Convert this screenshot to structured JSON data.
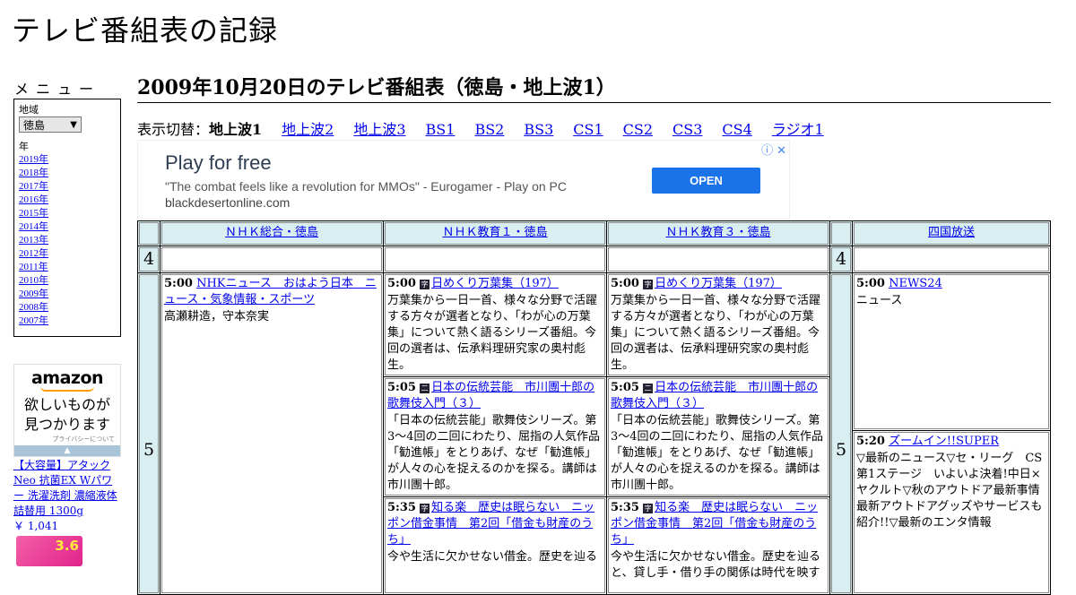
{
  "site": {
    "title": "テレビ番組表の記録"
  },
  "menu": {
    "heading": "メニュー",
    "region_label": "地域",
    "region_value": "徳島",
    "year_label": "年",
    "years": [
      "2019年",
      "2018年",
      "2017年",
      "2016年",
      "2015年",
      "2014年",
      "2013年",
      "2012年",
      "2011年",
      "2010年",
      "2009年",
      "2008年",
      "2007年"
    ]
  },
  "amazon_ad": {
    "logo": "amazon",
    "tagline_1": "欲しいものが",
    "tagline_2": "見つかります",
    "privacy": "プライバシーについて",
    "product_name": "【大容量】アタック Neo 抗菌EX Wパワー 洗濯洗剤 濃縮液体 詰替用 1300g",
    "product_price": "￥ 1,041",
    "product_badge": "3.6"
  },
  "page": {
    "heading": "2009年10月20日のテレビ番組表（徳島・地上波1）",
    "switch_label": "表示切替：",
    "current": "地上波1",
    "switch_links": [
      "地上波2",
      "地上波3",
      "BS1",
      "BS2",
      "BS3",
      "CS1",
      "CS2",
      "CS3",
      "CS4",
      "ラジオ1"
    ]
  },
  "google_ad": {
    "title": "Play for free",
    "quote": "\"The combat feels like a revolution for MMOs\" - Eurogamer - Play on PC",
    "domain": "blackdesertonline.com",
    "button": "OPEN",
    "info_icon": "ⓘ",
    "close_icon": "✕"
  },
  "schedule": {
    "channels": [
      "ＮＨＫ総合・徳島",
      "ＮＨＫ教育１・徳島",
      "ＮＨＫ教育３・徳島",
      "四国放送"
    ],
    "hours": [
      "4",
      "5"
    ],
    "programs": {
      "nhk_sogo": [
        {
          "time": "5:00",
          "title": "NHKニュース　おはよう日本　ニュース・気象情報・スポーツ",
          "desc": "高瀬耕造，守本奈実"
        }
      ],
      "nhk_edu1": [
        {
          "time": "5:00",
          "icon": "字",
          "title": "日めくり万葉集（197）",
          "desc": "万葉集から一日一首、様々な分野で活躍する方々が選者となり、「わが心の万葉集」について熱く語るシリーズ番組。今回の選者は、伝承料理研究家の奥村彪生。"
        },
        {
          "time": "5:05",
          "icon": "二",
          "title": "日本の伝統芸能　市川團十郎の歌舞伎入門（３）",
          "desc": "「日本の伝統芸能」歌舞伎シリーズ。第3～4回の二回にわたり、屈指の人気作品「勧進帳」をとりあげ、なぜ「勧進帳」が人々の心を捉えるのかを探る。講師は市川團十郎。"
        },
        {
          "time": "5:35",
          "icon": "字",
          "title": "知る楽　歴史は眠らない　ニッポン借金事情　第2回「借金も財産のうち」",
          "desc": "今や生活に欠かせない借金。歴史を辿る"
        }
      ],
      "nhk_edu3": [
        {
          "time": "5:00",
          "icon": "字",
          "title": "日めくり万葉集（197）",
          "desc": "万葉集から一日一首、様々な分野で活躍する方々が選者となり、「わが心の万葉集」について熱く語るシリーズ番組。今回の選者は、伝承料理研究家の奥村彪生。"
        },
        {
          "time": "5:05",
          "icon": "二",
          "title": "日本の伝統芸能　市川團十郎の歌舞伎入門（３）",
          "desc": "「日本の伝統芸能」歌舞伎シリーズ。第3～4回の二回にわたり、屈指の人気作品「勧進帳」をとりあげ、なぜ「勧進帳」が人々の心を捉えるのかを探る。講師は市川團十郎。"
        },
        {
          "time": "5:35",
          "icon": "字",
          "title": "知る楽　歴史は眠らない　ニッポン借金事情　第2回「借金も財産のうち」",
          "desc": "今や生活に欠かせない借金。歴史を辿ると、貸し手・借り手の関係は時代を映す"
        }
      ],
      "shikoku": [
        {
          "time": "5:00",
          "title": "NEWS24",
          "desc": "ニュース"
        },
        {
          "time": "5:20",
          "title": "ズームイン!!SUPER",
          "desc": "▽最新のニュース▽セ・リーグ　CS第1ステージ　いよいよ決着!中日×ヤクルト▽秋のアウトドア最新事情　最新アウトドアグッズやサービスも紹介!!▽最新のエンタ情報"
        }
      ]
    }
  }
}
